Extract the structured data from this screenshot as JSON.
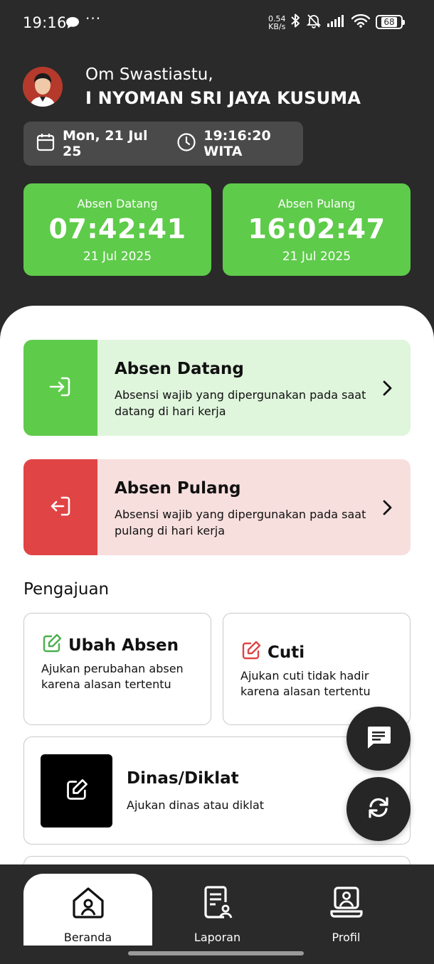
{
  "status_bar": {
    "time": "19:16",
    "dots": "···",
    "speed_value": "0.54",
    "speed_unit": "KB/s",
    "battery": "68"
  },
  "header": {
    "greeting": "Om Swastiastu,",
    "username": "I NYOMAN SRI JAYA KUSUMA",
    "date": "Mon, 21 Jul 25",
    "time": "19:16:20 WITA"
  },
  "attendance": {
    "arrival": {
      "label": "Absen Datang",
      "time": "07:42:41",
      "date": "21 Jul 2025"
    },
    "departure": {
      "label": "Absen Pulang",
      "time": "16:02:47",
      "date": "21 Jul 2025"
    }
  },
  "actions": {
    "check_in": {
      "title": "Absen Datang",
      "description": "Absensi wajib yang dipergunakan pada saat datang di hari kerja"
    },
    "check_out": {
      "title": "Absen Pulang",
      "description": "Absensi wajib yang dipergunakan pada saat pulang di hari kerja"
    }
  },
  "requests": {
    "section_title": "Pengajuan",
    "change_attendance": {
      "title": "Ubah Absen",
      "description": "Ajukan perubahan absen karena alasan tertentu"
    },
    "leave": {
      "title": "Cuti",
      "description": "Ajukan cuti tidak hadir karena alasan tertentu"
    },
    "duty": {
      "title": "Dinas/Diklat",
      "description": "Ajukan dinas atau diklat"
    }
  },
  "nav": {
    "home": "Beranda",
    "report": "Laporan",
    "profile": "Profil"
  },
  "colors": {
    "background": "#2a2a2a",
    "green": "#5ecb4a",
    "green_light": "#dff5dc",
    "red": "#e04444",
    "red_light": "#f7dfde"
  }
}
